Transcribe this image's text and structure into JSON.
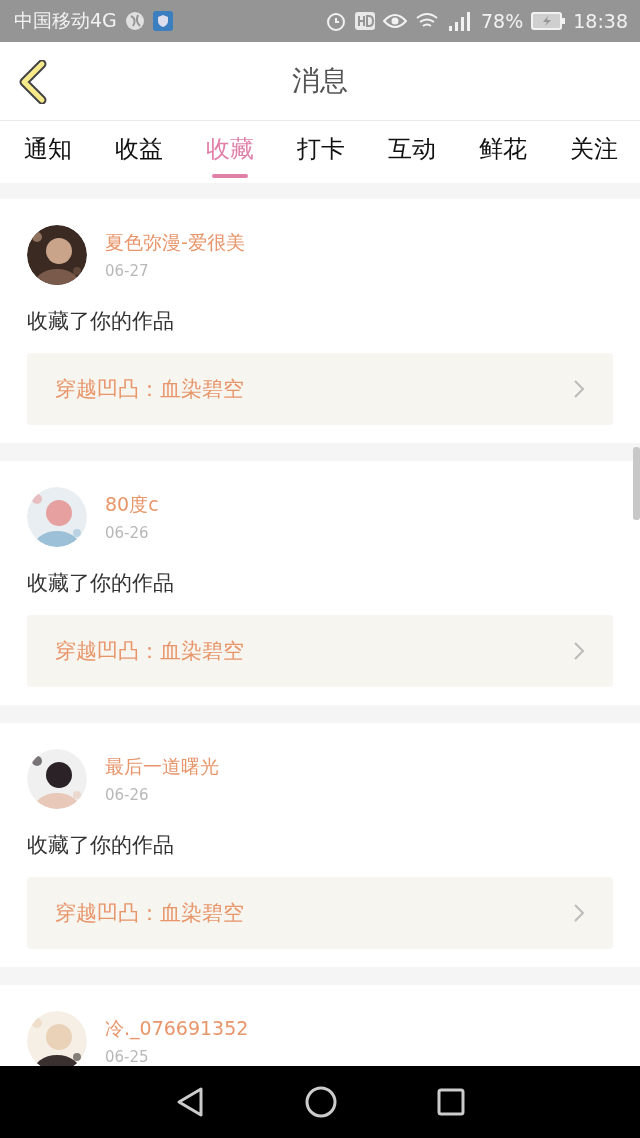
{
  "status_bar": {
    "carrier": "中国移动4G",
    "battery": "78%",
    "time": "18:38"
  },
  "header": {
    "title": "消息"
  },
  "tabs": [
    {
      "label": "通知",
      "selected": false
    },
    {
      "label": "收益",
      "selected": false
    },
    {
      "label": "收藏",
      "selected": true
    },
    {
      "label": "打卡",
      "selected": false
    },
    {
      "label": "互动",
      "selected": false
    },
    {
      "label": "鲜花",
      "selected": false
    },
    {
      "label": "关注",
      "selected": false
    }
  ],
  "messages": [
    {
      "user": "夏色弥漫-爱很美",
      "date": "06-27",
      "text": "收藏了你的作品",
      "work": "穿越凹凸：血染碧空"
    },
    {
      "user": "80度c",
      "date": "06-26",
      "text": "收藏了你的作品",
      "work": "穿越凹凸：血染碧空"
    },
    {
      "user": "最后一道曙光",
      "date": "06-26",
      "text": "收藏了你的作品",
      "work": "穿越凹凸：血染碧空"
    },
    {
      "user": "冷._076691352",
      "date": "06-25"
    }
  ]
}
